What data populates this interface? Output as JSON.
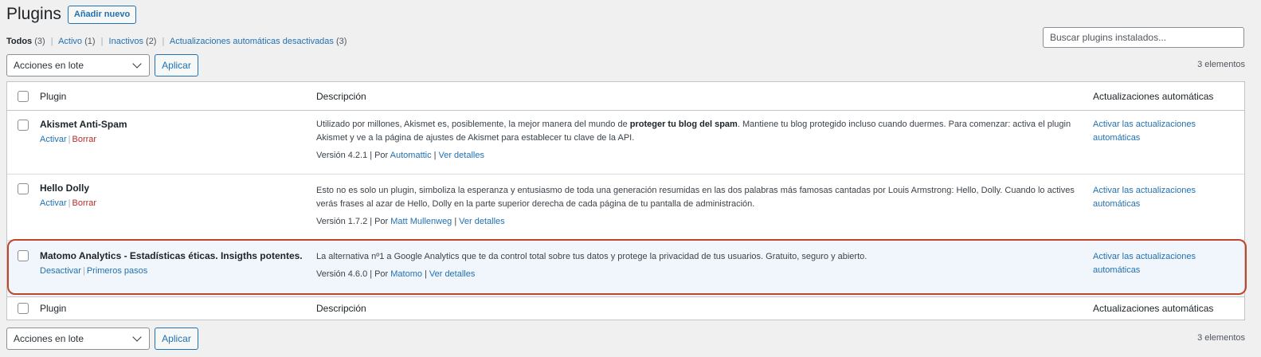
{
  "header": {
    "title": "Plugins",
    "add_new_label": "Añadir nuevo"
  },
  "filters": {
    "all": {
      "label": "Todos",
      "count": "(3)"
    },
    "active": {
      "label": "Activo",
      "count": "(1)"
    },
    "inactive": {
      "label": "Inactivos",
      "count": "(2)"
    },
    "auto_updates_disabled": {
      "label": "Actualizaciones automáticas desactivadas",
      "count": "(3)"
    },
    "separator": "|"
  },
  "search": {
    "placeholder": "Buscar plugins instalados..."
  },
  "tablenav": {
    "bulk_actions": "Acciones en lote",
    "apply_label": "Aplicar",
    "item_count": "3 elementos"
  },
  "columns": {
    "plugin": "Plugin",
    "description": "Descripción",
    "auto_updates": "Actualizaciones automáticas"
  },
  "plugins": [
    {
      "name": "Akismet Anti-Spam",
      "action1": "Activar",
      "action2": "Borrar",
      "desc_before": "Utilizado por millones, Akismet es, posiblemente, la mejor manera del mundo de ",
      "desc_bold": "proteger tu blog del spam",
      "desc_after": ". Mantiene tu blog protegido incluso cuando duermes. Para comenzar: activa el plugin Akismet y ve a la página de ajustes de Akismet para establecer tu clave de la API.",
      "version": "Versión 4.2.1",
      "by": "Por",
      "author": "Automattic",
      "details": "Ver detalles",
      "auto_update": "Activar las actualizaciones automáticas"
    },
    {
      "name": "Hello Dolly",
      "action1": "Activar",
      "action2": "Borrar",
      "desc_before": "Esto no es solo un plugin, simboliza la esperanza y entusiasmo de toda una generación resumidas en las dos palabras más famosas cantadas por Louis Armstrong: Hello, Dolly. Cuando lo actives verás frases al azar de Hello, Dolly en la parte superior derecha de cada página de tu pantalla de administración.",
      "desc_bold": "",
      "desc_after": "",
      "version": "Versión 1.7.2",
      "by": "Por",
      "author": "Matt Mullenweg",
      "details": "Ver detalles",
      "auto_update": "Activar las actualizaciones automáticas"
    },
    {
      "name": "Matomo Analytics - Estadísticas éticas. Insigths potentes.",
      "action1": "Desactivar",
      "action2": "Primeros pasos",
      "desc_before": "La alternativa nº1 a Google Analytics que te da control total sobre tus datos y protege la privacidad de tus usuarios. Gratuito, seguro y abierto.",
      "desc_bold": "",
      "desc_after": "",
      "version": "Versión 4.6.0",
      "by": "Por",
      "author": "Matomo",
      "details": "Ver detalles",
      "auto_update": "Activar las actualizaciones automáticas"
    }
  ],
  "colors": {
    "link": "#2271b1",
    "delete": "#b32d2e",
    "active_row_bg": "#f0f6fc",
    "highlight_border": "#c0462a"
  }
}
